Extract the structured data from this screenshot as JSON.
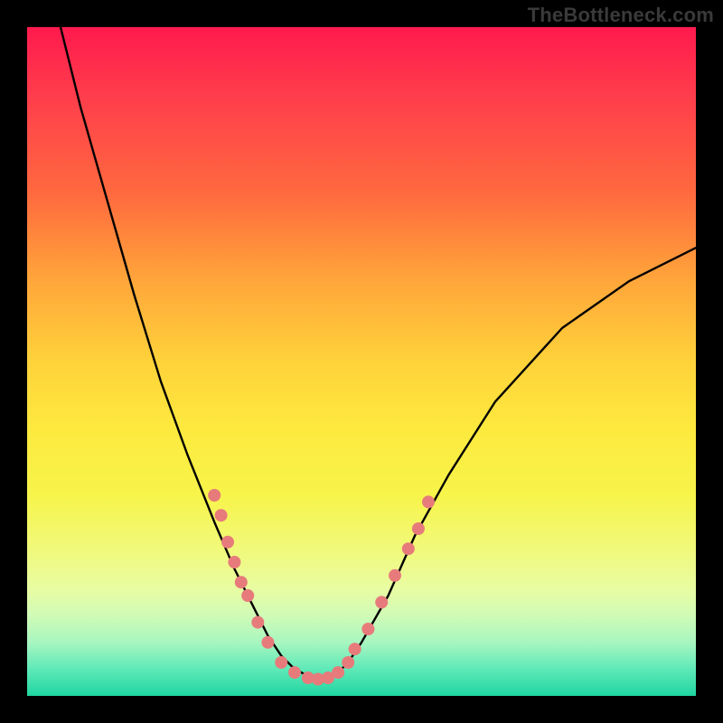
{
  "watermark": "TheBottleneck.com",
  "chart_data": {
    "type": "line",
    "title": "",
    "xlabel": "",
    "ylabel": "",
    "xlim": [
      0,
      100
    ],
    "ylim": [
      0,
      100
    ],
    "grid": false,
    "legend": "none",
    "series": [
      {
        "name": "curve",
        "x": [
          5,
          8,
          12,
          16,
          20,
          24,
          28,
          31,
          34,
          36,
          38,
          40,
          42,
          44,
          46,
          48,
          50,
          54,
          58,
          63,
          70,
          80,
          90,
          100
        ],
        "y": [
          100,
          88,
          74,
          60,
          47,
          36,
          26,
          19,
          13,
          9,
          6,
          4,
          3,
          2.5,
          3,
          5,
          8,
          15,
          24,
          33,
          44,
          55,
          62,
          67
        ]
      }
    ],
    "markers": {
      "name": "highlight-points",
      "color": "#e77b7b",
      "radius_px": 7,
      "points": [
        {
          "x": 28,
          "y": 30
        },
        {
          "x": 29,
          "y": 27
        },
        {
          "x": 30,
          "y": 23
        },
        {
          "x": 31,
          "y": 20
        },
        {
          "x": 32,
          "y": 17
        },
        {
          "x": 33,
          "y": 15
        },
        {
          "x": 34.5,
          "y": 11
        },
        {
          "x": 36,
          "y": 8
        },
        {
          "x": 38,
          "y": 5
        },
        {
          "x": 40,
          "y": 3.5
        },
        {
          "x": 42,
          "y": 2.7
        },
        {
          "x": 43.5,
          "y": 2.5
        },
        {
          "x": 45,
          "y": 2.7
        },
        {
          "x": 46.5,
          "y": 3.5
        },
        {
          "x": 48,
          "y": 5
        },
        {
          "x": 49,
          "y": 7
        },
        {
          "x": 51,
          "y": 10
        },
        {
          "x": 53,
          "y": 14
        },
        {
          "x": 55,
          "y": 18
        },
        {
          "x": 57,
          "y": 22
        },
        {
          "x": 58.5,
          "y": 25
        },
        {
          "x": 60,
          "y": 29
        }
      ]
    }
  }
}
